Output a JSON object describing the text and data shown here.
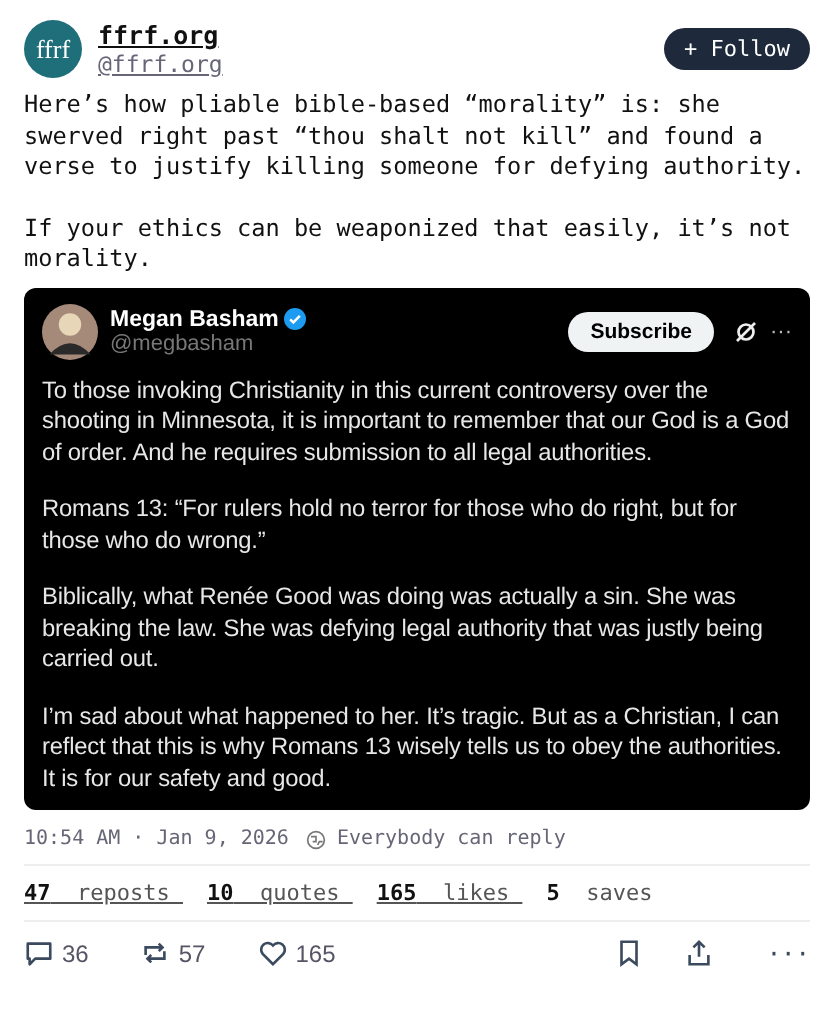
{
  "author": {
    "avatar_text": "ffrf",
    "name": "ffrf.org",
    "handle": "@ffrf.org"
  },
  "follow_button": {
    "icon": "+",
    "label": "Follow"
  },
  "post_paragraphs": [
    "Here’s how pliable bible-based “morality” is: she swerved right past “thou shalt not kill” and found a verse to justify killing someone for defying authority.",
    "If your ethics can be weaponized that easily, it’s not morality."
  ],
  "embedded_post": {
    "name": "Megan Basham",
    "verified": true,
    "handle": "@megbasham",
    "subscribe_label": "Subscribe",
    "more": "···",
    "paragraphs": [
      "To those invoking Christianity in this current controversy over the shooting in Minnesota, it is important to remember that our God is a God of order. And he requires submission to all legal authorities.",
      "Romans 13: “For rulers hold no terror for those who do right, but for those who do wrong.”",
      "Biblically, what Renée Good was doing was actually a sin. She was breaking the law. She was defying legal authority that was justly being carried out.",
      "I’m sad about what happened to her. It’s tragic. But as a Christian, I can reflect that this is why Romans 13 wisely tells us to obey the authorities. It is for our safety and good."
    ]
  },
  "timestamp": "10:54 AM · Jan 9, 2026",
  "reply_setting": "Everybody can reply",
  "stats": [
    {
      "count": "47",
      "label": "reposts",
      "link": true
    },
    {
      "count": "10",
      "label": "quotes",
      "link": true
    },
    {
      "count": "165",
      "label": "likes",
      "link": true
    },
    {
      "count": "5",
      "label": "saves",
      "link": false
    }
  ],
  "actions": [
    {
      "kind": "reply",
      "count": "36"
    },
    {
      "kind": "repost",
      "count": "57"
    },
    {
      "kind": "like",
      "count": "165"
    }
  ],
  "more_menu": "···"
}
